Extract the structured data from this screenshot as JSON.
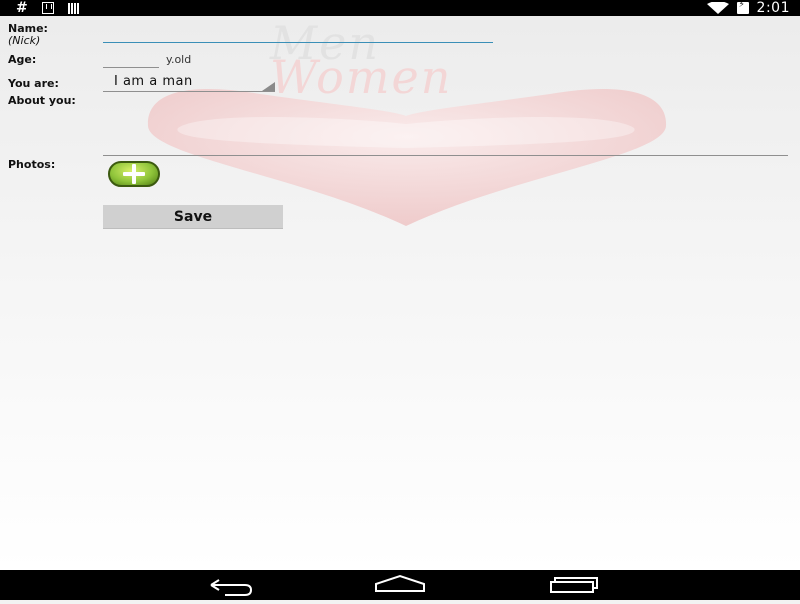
{
  "status_bar": {
    "left_icons": [
      "hash-icon",
      "download-icon",
      "barcode-icon"
    ],
    "hash_glyph": "#",
    "time": "2:01",
    "right_icons": [
      "wifi-icon",
      "battery-charging-icon"
    ]
  },
  "background": {
    "watermark_men": "Men",
    "watermark_women": "Women",
    "art_icon": "heart-icon"
  },
  "form": {
    "name_label": "Name:",
    "name_hint": "(Nick)",
    "name_value": "",
    "age_label": "Age:",
    "age_value": "",
    "age_suffix": "y.old",
    "gender_label": "You are:",
    "gender_value": "I am a man",
    "about_label": "About you:",
    "about_value": "",
    "photos_label": "Photos:",
    "add_photo_icon": "add-photo-icon",
    "save_label": "Save"
  },
  "nav_bar": {
    "icons": [
      "back-icon",
      "home-icon",
      "recents-icon"
    ]
  },
  "colors": {
    "focused_underline": "#3a8fb7",
    "add_button_green": "#8fc43a",
    "save_button_bg": "#d0d0d0"
  }
}
